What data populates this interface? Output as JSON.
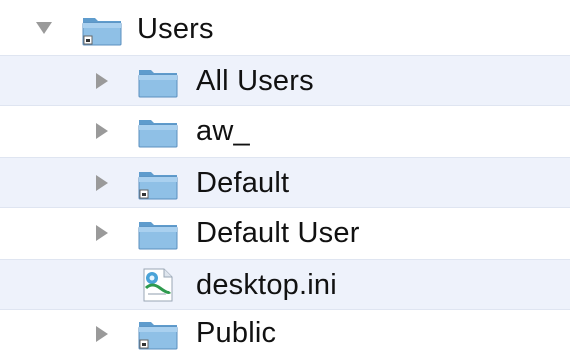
{
  "tree": {
    "root": {
      "label": "Users",
      "icon": "shared-folder-icon",
      "expanded": true
    },
    "children": [
      {
        "label": "All Users",
        "icon": "folder-icon",
        "type": "folder"
      },
      {
        "label": "aw_",
        "icon": "folder-icon",
        "type": "folder"
      },
      {
        "label": "Default",
        "icon": "shared-folder-icon",
        "type": "folder"
      },
      {
        "label": "Default User",
        "icon": "folder-icon",
        "type": "folder"
      },
      {
        "label": "desktop.ini",
        "icon": "ini-file-icon",
        "type": "file"
      },
      {
        "label": "Public",
        "icon": "shared-folder-icon",
        "type": "folder"
      }
    ]
  },
  "colors": {
    "alternate_row": "#eef2fb",
    "folder_blue": "#7fb4dc",
    "disclosure_gray": "#9a9a9a"
  }
}
